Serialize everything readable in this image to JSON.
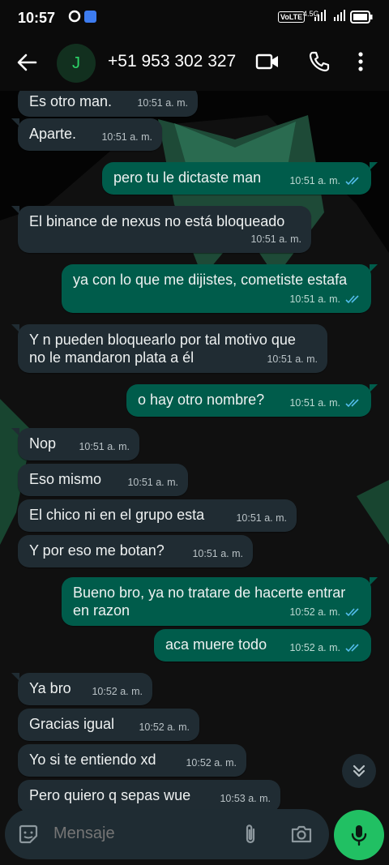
{
  "status": {
    "time": "10:57",
    "volte": "VoLTE",
    "net": "4.5G"
  },
  "header": {
    "avatar_letter": "J",
    "contact": "+51 953 302 327"
  },
  "messages": [
    {
      "dir": "in",
      "text": "Es otro man.",
      "time": "10:51 a. m."
    },
    {
      "dir": "in",
      "text": "Aparte.",
      "time": "10:51 a. m."
    },
    {
      "dir": "out",
      "text": "pero tu le dictaste man",
      "time": "10:51 a. m."
    },
    {
      "dir": "in",
      "text": "El binance de nexus no está bloqueado",
      "time": "10:51 a. m."
    },
    {
      "dir": "out",
      "text": "ya con lo que me dijistes, cometiste estafa",
      "time": "10:51 a. m."
    },
    {
      "dir": "in",
      "text": "Y n pueden bloquearlo por tal motivo que no le mandaron plata a él",
      "time": "10:51 a. m."
    },
    {
      "dir": "out",
      "text": "o hay otro nombre?",
      "time": "10:51 a. m."
    },
    {
      "dir": "in",
      "text": "Nop",
      "time": "10:51 a. m."
    },
    {
      "dir": "in",
      "text": "Eso mismo",
      "time": "10:51 a. m."
    },
    {
      "dir": "in",
      "text": "El chico ni en el grupo esta",
      "time": "10:51 a. m."
    },
    {
      "dir": "in",
      "text": "Y por eso me botan?",
      "time": "10:51 a. m."
    },
    {
      "dir": "out",
      "text": "Bueno bro, ya no tratare de hacerte entrar en razon",
      "time": "10:52 a. m."
    },
    {
      "dir": "out",
      "text": "aca muere todo",
      "time": "10:52 a. m."
    },
    {
      "dir": "in",
      "text": "Ya bro",
      "time": "10:52 a. m."
    },
    {
      "dir": "in",
      "text": "Gracias igual",
      "time": "10:52 a. m."
    },
    {
      "dir": "in",
      "text": "Yo si te entiendo xd",
      "time": "10:52 a. m."
    },
    {
      "dir": "in",
      "text": "Pero quiero q sepas wue",
      "time": "10:53 a. m."
    }
  ],
  "composer": {
    "placeholder": "Mensaje"
  },
  "colors": {
    "incoming": "#202c33",
    "outgoing": "#005c4b",
    "accent": "#21c063",
    "tick": "#53bdeb"
  }
}
